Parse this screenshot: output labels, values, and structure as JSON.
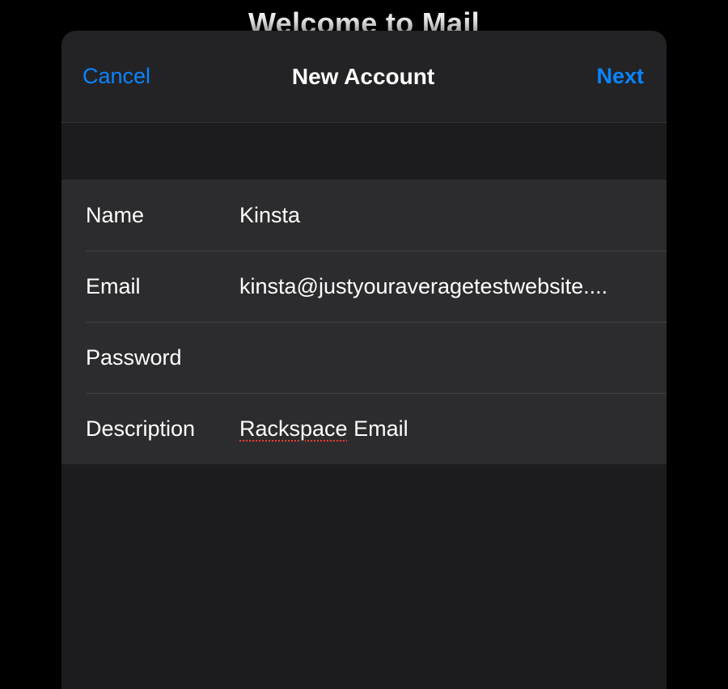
{
  "bg_title": "Welcome to Mail",
  "navbar": {
    "cancel_label": "Cancel",
    "title": "New Account",
    "next_label": "Next"
  },
  "fields": {
    "name": {
      "label": "Name",
      "value": "Kinsta"
    },
    "email": {
      "label": "Email",
      "value": "kinsta@justyouraveragetestwebsite...."
    },
    "password": {
      "label": "Password",
      "value": ""
    },
    "description": {
      "label": "Description",
      "value_word": "Rackspace",
      "value_rest": " Email"
    }
  }
}
